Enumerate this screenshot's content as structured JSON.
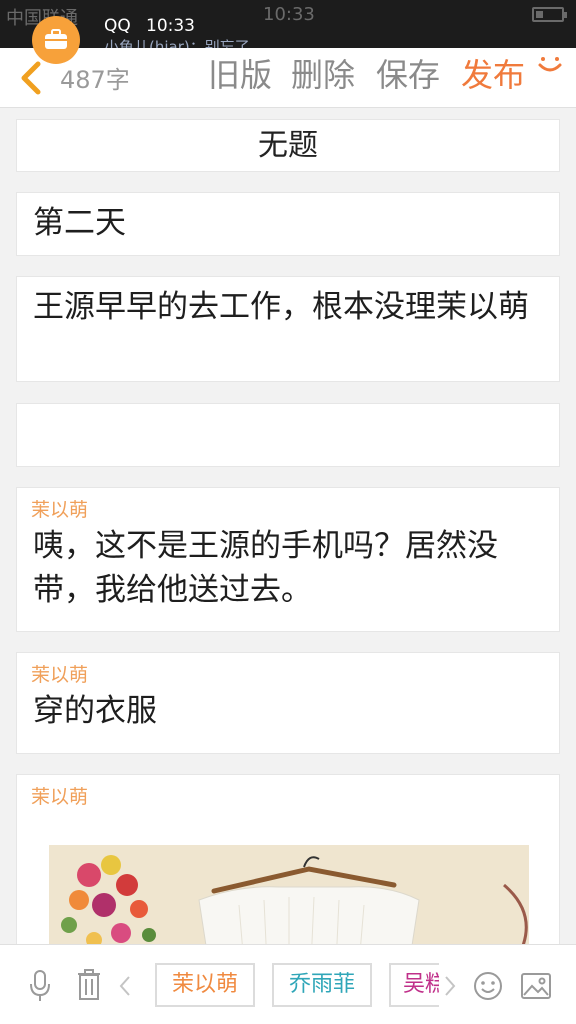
{
  "status_bar": {
    "carrier": "中国联通",
    "time": "10:33"
  },
  "notification": {
    "app": "QQ",
    "time": "10:33",
    "message": "小鱼儿(hiar)：别忘了"
  },
  "toolbar": {
    "word_count": "487字",
    "old_version_label": "旧版",
    "delete_label": "删除",
    "save_label": "保存",
    "publish_label": "发布",
    "accent_color": "#f07a3c"
  },
  "document": {
    "title": "无题",
    "blocks": [
      {
        "type": "narration",
        "text": "第二天"
      },
      {
        "type": "narration",
        "text": "王源早早的去工作，根本没理茉以萌"
      },
      {
        "type": "narration",
        "text": ""
      },
      {
        "type": "dialogue",
        "speaker": "茉以萌",
        "text": "咦，这不是王源的手机吗？居然没带，我给他送过去。"
      },
      {
        "type": "dialogue",
        "speaker": "茉以萌",
        "text": "穿的衣服"
      },
      {
        "type": "image",
        "speaker": "茉以萌"
      }
    ]
  },
  "bottom_bar": {
    "characters": [
      "茉以萌",
      "乔雨菲",
      "吴糕"
    ],
    "icons": [
      "microphone-icon",
      "trash-icon",
      "chevron-left-icon",
      "chevron-right-icon",
      "emoji-icon",
      "image-icon"
    ]
  }
}
